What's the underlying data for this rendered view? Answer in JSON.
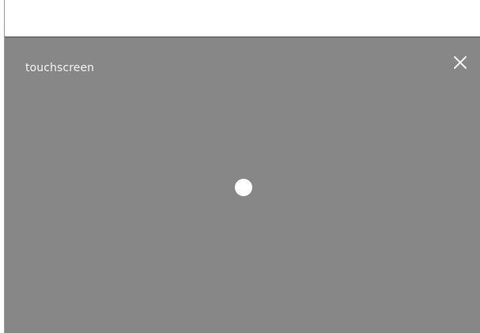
{
  "panel": {
    "title": "touchscreen",
    "close_icon": "close-icon"
  },
  "colors": {
    "panel_background": "#878787",
    "title_text": "#f2f2f2",
    "touch_dot": "#ffffff"
  }
}
